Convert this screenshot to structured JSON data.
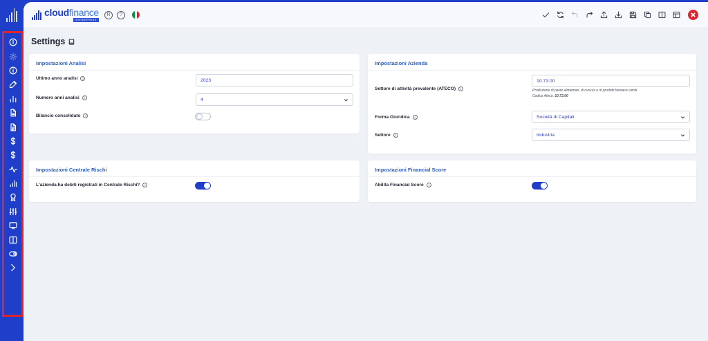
{
  "app": {
    "brand_name_bold": "cloud",
    "brand_name_light": "finance",
    "brand_sub": "ENTERPRISE",
    "registered_glyph": "R",
    "help_glyph": "?",
    "language_flag_colors": [
      "#009246",
      "#ffffff",
      "#ce2b37"
    ]
  },
  "sidebar": {
    "highlight_color": "#e0242c",
    "icons": [
      {
        "name": "info-icon",
        "dim": false
      },
      {
        "name": "gear-icon",
        "dim": true
      },
      {
        "name": "info-circle-icon",
        "dim": false
      },
      {
        "name": "edit-icon",
        "dim": false
      },
      {
        "name": "bar-chart-icon",
        "dim": false
      },
      {
        "name": "document-icon",
        "dim": false
      },
      {
        "name": "document-lines-icon",
        "dim": false
      },
      {
        "name": "dollar-icon",
        "dim": false
      },
      {
        "name": "dollar-alt-icon",
        "dim": false
      },
      {
        "name": "activity-icon",
        "dim": false
      },
      {
        "name": "signal-chart-icon",
        "dim": false
      },
      {
        "name": "award-icon",
        "dim": false
      },
      {
        "name": "sliders-icon",
        "dim": false
      },
      {
        "name": "monitor-icon",
        "dim": false
      },
      {
        "name": "columns-icon",
        "dim": false
      },
      {
        "name": "toggle-icon",
        "dim": false
      },
      {
        "name": "chevron-right-icon",
        "dim": false
      }
    ]
  },
  "toolbar": {
    "items": [
      {
        "name": "check-icon",
        "disabled": false
      },
      {
        "name": "refresh-icon",
        "disabled": false
      },
      {
        "name": "undo-icon",
        "disabled": true
      },
      {
        "name": "redo-icon",
        "disabled": false
      },
      {
        "name": "upload-icon",
        "disabled": false
      },
      {
        "name": "download-icon",
        "disabled": false
      },
      {
        "name": "save-icon",
        "disabled": false
      },
      {
        "name": "copy-icon",
        "disabled": false
      },
      {
        "name": "split-view-icon",
        "disabled": false
      },
      {
        "name": "layout-icon",
        "disabled": false
      }
    ],
    "close_color": "#e0242c"
  },
  "page": {
    "title": "Settings"
  },
  "analisi": {
    "title": "Impostazioni Analisi",
    "ultimo_anno_label": "Ultimo anno analisi",
    "ultimo_anno_value": "2023",
    "numero_anni_label": "Numero anni analisi",
    "numero_anni_value": "4",
    "bilancio_label": "Bilancio consolidato",
    "bilancio_enabled": false
  },
  "azienda": {
    "title": "Impostazioni Azienda",
    "settore_attivita_label": "Settore di attività prevalente (ATECO)",
    "settore_attivita_value": "10.73.00",
    "ateco_description": "Produzione di paste alimentari, di cuscus e di prodotti farinacei simili",
    "codice_ateco_label": "Codice Ateco:",
    "codice_ateco_value": "10.73.00",
    "forma_label": "Forma Giuridica",
    "forma_value": "Società di Capitali",
    "settore_label": "Settore",
    "settore_value": "Industria"
  },
  "centrale_rischi": {
    "title": "Impostazioni Centrale Rischi",
    "debiti_label": "L'azienda ha debiti registrati in Centrale Rischi?",
    "debiti_enabled": true
  },
  "financial_score": {
    "title": "Impostazioni Financial Score",
    "abilita_label": "Abilita Financial Score",
    "abilita_enabled": true
  },
  "colors": {
    "primary": "#1f3ec9",
    "accent_text": "#2f5fc8",
    "background": "#eef1f6"
  }
}
